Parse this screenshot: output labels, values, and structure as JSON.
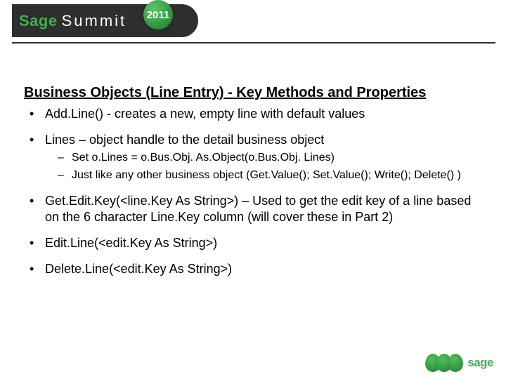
{
  "brand": {
    "sage": "Sage",
    "summit": "Summit",
    "year": "2011",
    "footer": "sage"
  },
  "slide": {
    "title": "Business Objects (Line Entry) - Key Methods and Properties",
    "bullets": [
      {
        "text": "Add.Line()  - creates a new, empty line with default values"
      },
      {
        "text": "Lines – object handle to the detail business object",
        "sub": [
          "Set o.Lines = o.Bus.Obj. As.Object(o.Bus.Obj. Lines)",
          "Just like any other business object (Get.Value(); Set.Value(); Write(); Delete() )"
        ]
      },
      {
        "text": "Get.Edit.Key(<line.Key As String>) – Used to get the edit key of a line based on the 6 character Line.Key column (will cover these in Part 2)"
      },
      {
        "text": "Edit.Line(<edit.Key As String>)"
      },
      {
        "text": "Delete.Line(<edit.Key As String>)"
      }
    ]
  }
}
